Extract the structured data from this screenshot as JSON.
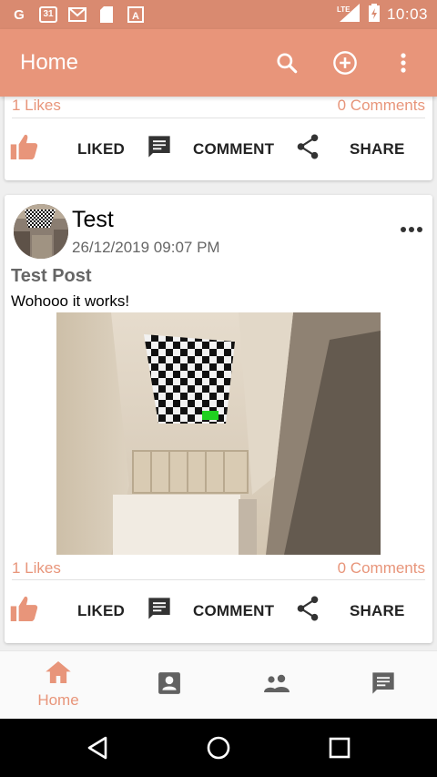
{
  "status_bar": {
    "time": "10:03",
    "network": "LTE",
    "left_icons": [
      "g-icon",
      "calendar-icon",
      "gmail-icon",
      "sd-card-icon",
      "a-icon"
    ],
    "calendar_day": "31"
  },
  "app_bar": {
    "title": "Home",
    "icons": [
      "search-icon",
      "add-circle-icon",
      "more-vert-icon"
    ]
  },
  "posts": [
    {
      "likes": "1 Likes",
      "comments": "0 Comments",
      "like_label": "LIKED",
      "comment_label": "COMMENT",
      "share_label": "SHARE"
    },
    {
      "author": "Test",
      "timestamp": "26/12/2019 09:07 PM",
      "title": "Test Post",
      "body": "Wohooo it works!",
      "likes": "1 Likes",
      "comments": "0 Comments",
      "like_label": "LIKED",
      "comment_label": "COMMENT",
      "share_label": "SHARE"
    }
  ],
  "bottom_nav": {
    "items": [
      {
        "label": "Home",
        "icon": "home-icon",
        "active": true
      },
      {
        "label": "",
        "icon": "contact-card-icon",
        "active": false
      },
      {
        "label": "",
        "icon": "people-icon",
        "active": false
      },
      {
        "label": "",
        "icon": "chat-icon",
        "active": false
      }
    ]
  },
  "colors": {
    "status_bar": "#d98a70",
    "app_bar": "#e8957a",
    "accent": "#e8957a",
    "icon_gray": "#616161"
  }
}
